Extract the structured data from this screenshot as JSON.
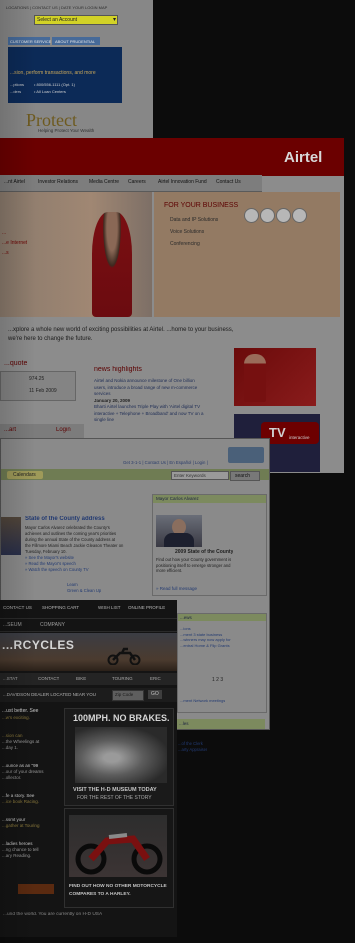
{
  "bank": {
    "toplinks": "LOCATIONS | CONTACT US | DATE YOUR LOGIN MAP",
    "select_value": "Select an Account",
    "tabs": [
      "CUSTOMER SERVICE",
      "ABOUT PRUDENTIAL"
    ],
    "banner_text": "...sion, perform transactions, and more",
    "rows": [
      [
        "...ptions",
        "• 800/556-1111 (Opt. 1)"
      ],
      [
        "...ders",
        "• All Loan Centers"
      ]
    ],
    "protect_title": "Protect",
    "protect_sub": "Helping Protect Your Wealth"
  },
  "airtel": {
    "logo": "Airtel",
    "nav": [
      "...nt Airtel",
      "Investor Relations",
      "Media Centre",
      "Careers",
      "Airtel Innovation Fund",
      "Contact Us"
    ],
    "business_title": "FOR YOUR BUSINESS",
    "business_items": [
      "Data and IP Solutions",
      "Voice Solutions",
      "Conferencing"
    ],
    "left_items": [
      "...",
      "...e Internet",
      "...s"
    ],
    "tagline": "...xplore a whole new world of exciting possibilities at Airtel. ...home to your business, we're here to change the future.",
    "quote_title": "...quote",
    "quote_rows": [
      "974.25",
      "11 Feb 2009"
    ],
    "news_title": "news highlights",
    "news_lines": [
      "Airtel and Nokia announce milestone of One billion",
      "users, introduce a broad range of new m-commerce",
      "services",
      "January 20, 2009",
      "Bharti Airtel launches Triple Play with 'Airtel digital TV",
      "interactive + Telephone + Broadband' and now TV on a",
      "single line"
    ],
    "start_label": "...art",
    "login_label": "Login",
    "dtv_label": "TV",
    "dtv_sub": "interactive"
  },
  "county": {
    "toplinks": "Get 3-1-1 | Contact Us | En Español | Login |",
    "calendars": "Calendars",
    "search_placeholder": "Enter Keywords",
    "search_button": "search",
    "headline": "State of the County address",
    "body_lines": [
      "Mayor Carlos Alvarez celebrated the County's",
      "achieves and outlines the coming year's priorities",
      "during the annual State of the County address at",
      "the Fillmore Miami Beach Jackie Gleason Theater on",
      "Tuesday, February 10.",
      "» See the Mayor's website",
      "» Read the Mayor's speech",
      "» Watch the speech on County TV"
    ],
    "sidebar_title": "Mayor Carlos Alvarez",
    "sidebar_caption": "2009 State of the County",
    "sidebar_text": [
      "Find out how your County government is",
      "positioning itself to emerge stronger and",
      "more efficient."
    ],
    "sidebar_link": "» Read full message",
    "news_title": "...ews",
    "news_lines": [
      "...ions",
      "...ment 3 state business",
      "...winners may now apply for",
      "...entral Home & Flip Grants"
    ],
    "pager": [
      "1",
      "2",
      "3"
    ],
    "meetings": "...ment Network meetings",
    "bottom_title": "...les",
    "bottom_links": [
      "...of the Clerk",
      "...arty Appraiser"
    ],
    "links_small": [
      "Learn",
      "Green & Clean Up"
    ]
  },
  "hd": {
    "toplinks": [
      "CONTACT US",
      "SHOPPING CART",
      "WISH LIST",
      "ONLINE PROFILE"
    ],
    "nav": [
      "...SEUM",
      "COMPANY"
    ],
    "hero_title": "...RCYCLES",
    "menu": [
      "...STAT",
      "CONTACT",
      "BIKE",
      "TOURING",
      "ERIC"
    ],
    "dealer_label": "...DAVIDSON DEALER LOCATED NEAR YOU",
    "zip_placeholder": "Zip Code",
    "go_label": "GO",
    "left_blocks": [
      [
        "...ust better. See",
        "...w's exciting."
      ],
      [
        "...sion can",
        "...the Wheelings at",
        "...day 1."
      ],
      [
        "...ounce as an \"99",
        "...our of your dreams",
        "...ollector."
      ],
      [
        "...fe a story. See",
        "...ice book Racing."
      ],
      [
        "...ssmt your",
        "...gather at Touring"
      ],
      [
        "...ladies heroes",
        "...ng chance to tell",
        "...ary Reading."
      ]
    ],
    "museum_headline": "100MPH. NO BRAKES.",
    "museum_caption1": "VISIT THE H-D MUSEUM TODAY",
    "museum_caption2": "FOR THE REST OF THE STORY",
    "moto_caption1": "FIND OUT HOW NO OTHER MOTORCYCLE",
    "moto_caption2": "COMPARES TO A HARLEY.",
    "footer": "...und the world. You are currently on H-D USA"
  }
}
